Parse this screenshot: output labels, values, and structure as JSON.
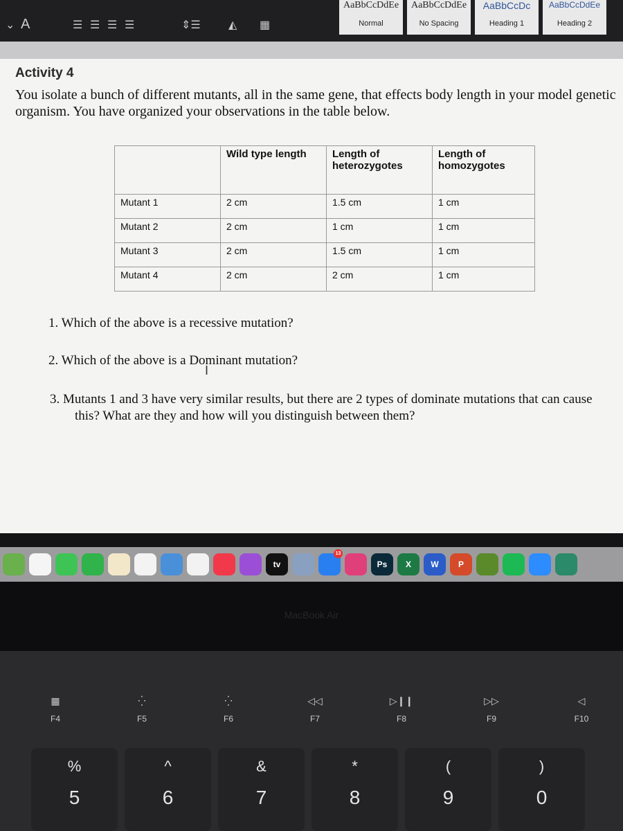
{
  "toolbar": {
    "font_color": "A",
    "styles": [
      {
        "preview": "AaBbCcDdEe",
        "name": "Normal"
      },
      {
        "preview": "AaBbCcDdEe",
        "name": "No Spacing"
      },
      {
        "preview": "AaBbCcDc",
        "name": "Heading 1"
      },
      {
        "preview": "AaBbCcDdEe",
        "name": "Heading 2"
      }
    ]
  },
  "document": {
    "heading": "Activity 4",
    "intro": "You isolate a bunch of different mutants, all in the same gene, that effects body length in your model genetic organism. You have organized your observations in the table below.",
    "table": {
      "headers": [
        "",
        "Wild type length",
        "Length of heterozygotes",
        "Length of homozygotes"
      ],
      "rows": [
        [
          "Mutant 1",
          "2 cm",
          "1.5 cm",
          "1 cm"
        ],
        [
          "Mutant 2",
          "2 cm",
          "1 cm",
          "1 cm"
        ],
        [
          "Mutant 3",
          "2 cm",
          "1.5 cm",
          "1 cm"
        ],
        [
          "Mutant 4",
          "2 cm",
          "2 cm",
          "1 cm"
        ]
      ]
    },
    "questions": [
      "1. Which of the above is a recessive mutation?",
      "2. Which of the above is a Dominant mutation?",
      "3. Mutants 1 and 3 have very similar results, but there are 2 types of dominate mutations that can cause this? What are they and how will you distinguish between them?"
    ]
  },
  "dock": {
    "app_store_badge": "13",
    "apps": [
      "Maps",
      "Photos",
      "Messages",
      "FaceTime",
      "Pages",
      "Numbers",
      "Keynote",
      "News",
      "Music",
      "Podcasts",
      "tv",
      "Preview",
      "App Store",
      "Creative Cloud",
      "Ps",
      "X",
      "W",
      "P",
      "Minecraft",
      "Spotify",
      "Zoom",
      "Finder"
    ]
  },
  "laptop": {
    "brand": "MacBook Air"
  },
  "keyboard": {
    "fkeys": [
      {
        "label": "F4",
        "glyph": "▦"
      },
      {
        "label": "F5",
        "glyph": "⁛"
      },
      {
        "label": "F6",
        "glyph": "⁛"
      },
      {
        "label": "F7",
        "glyph": "◁◁"
      },
      {
        "label": "F8",
        "glyph": "▷❙❙"
      },
      {
        "label": "F9",
        "glyph": "▷▷"
      },
      {
        "label": "F10",
        "glyph": "◁"
      }
    ],
    "numkeys": [
      {
        "shift": "%",
        "num": "5"
      },
      {
        "shift": "^",
        "num": "6"
      },
      {
        "shift": "&",
        "num": "7"
      },
      {
        "shift": "*",
        "num": "8"
      },
      {
        "shift": "(",
        "num": "9"
      },
      {
        "shift": ")",
        "num": "0"
      }
    ]
  }
}
